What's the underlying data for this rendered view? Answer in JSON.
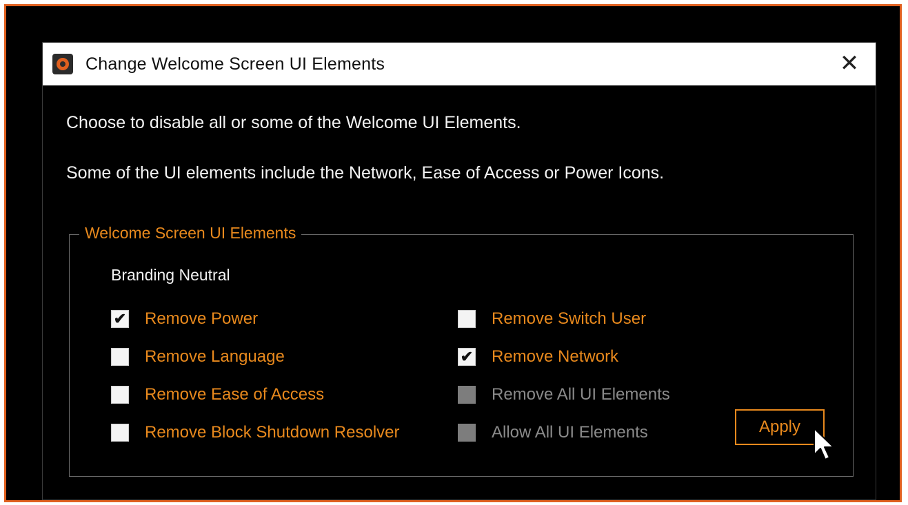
{
  "window": {
    "title": "Change Welcome Screen UI Elements",
    "close_glyph": "✕",
    "icon": "app-logo-icon"
  },
  "description": {
    "line1": "Choose to disable all or some of the Welcome UI Elements.",
    "line2": "Some of the UI elements include the Network, Ease of Access or Power Icons."
  },
  "group": {
    "legend": "Welcome Screen UI Elements",
    "subheading": "Branding Neutral"
  },
  "options": [
    {
      "label": "Remove Power",
      "checked": true,
      "enabled": true
    },
    {
      "label": "Remove Language",
      "checked": false,
      "enabled": true
    },
    {
      "label": "Remove Ease of Access",
      "checked": false,
      "enabled": true
    },
    {
      "label": "Remove Block Shutdown Resolver",
      "checked": false,
      "enabled": true
    },
    {
      "label": "Remove Switch User",
      "checked": false,
      "enabled": true
    },
    {
      "label": "Remove Network",
      "checked": true,
      "enabled": true
    },
    {
      "label": "Remove All UI Elements",
      "checked": false,
      "enabled": false
    },
    {
      "label": "Allow All UI Elements",
      "checked": false,
      "enabled": false
    }
  ],
  "apply_label": "Apply",
  "colors": {
    "accent": "#e8891d",
    "frame_border": "#e0601f",
    "background": "#000000"
  }
}
